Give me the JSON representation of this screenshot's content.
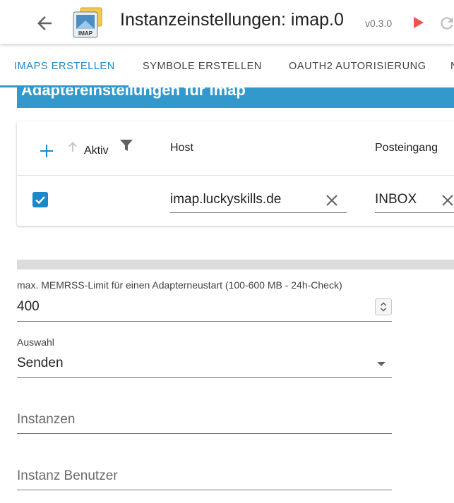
{
  "header": {
    "title": "Instanzeinstellungen: imap.0",
    "version": "v0.3.0",
    "back_icon": "arrow-left-icon",
    "logo_text": "IMAP",
    "play_icon": "play-icon",
    "reload_icon": "reload-icon",
    "accent_color": "#e53935"
  },
  "tabs": [
    {
      "label": "IMAPS ERSTELLEN",
      "active": true
    },
    {
      "label": "SYMBOLE ERSTELLEN",
      "active": false
    },
    {
      "label": "OAUTH2 AUTORISIERUNG",
      "active": false
    },
    {
      "label": "N",
      "active": false
    }
  ],
  "section": {
    "banner_title": "Adaptereinstellungen für imap",
    "banner_color": "#3399cc"
  },
  "table": {
    "columns": [
      "Aktiv",
      "Host",
      "Posteingang"
    ],
    "rows": [
      {
        "aktiv": true,
        "host": "imap.luckyskills.de",
        "posteingang": "INBOX"
      }
    ]
  },
  "form": {
    "memrss": {
      "label": "max. MEMRSS-Limit für einen Adapterneustart (100-600 MB - 24h-Check)",
      "value": "400"
    },
    "auswahl": {
      "label": "Auswahl",
      "value": "Senden"
    },
    "instanzen": {
      "placeholder": "Instanzen"
    },
    "instanz_benutzer": {
      "placeholder": "Instanz Benutzer"
    }
  }
}
